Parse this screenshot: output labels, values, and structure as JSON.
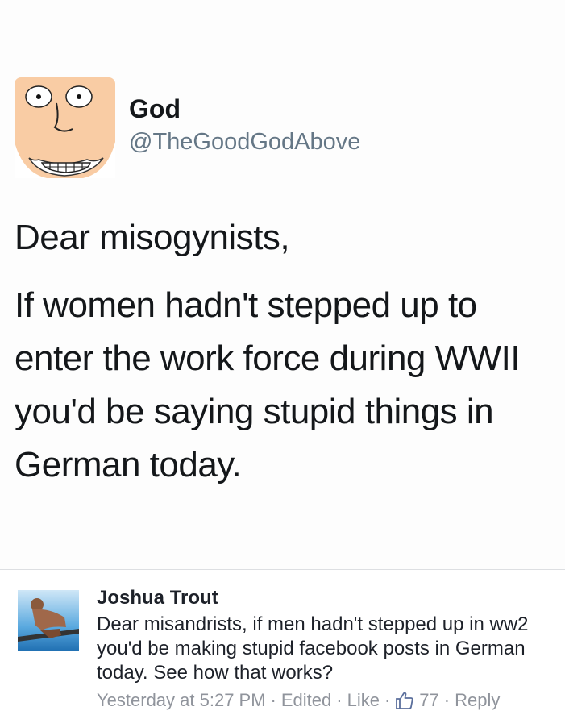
{
  "tweet": {
    "author": {
      "name": "God",
      "handle": "@TheGoodGodAbove",
      "avatar_icon": "cartoon-god-face-icon"
    },
    "greeting": "Dear misogynists,",
    "body": "If women hadn't stepped up to enter the work force during WWII you'd be saying stupid things in German today."
  },
  "comment": {
    "author": "Joshua Trout",
    "avatar_icon": "profile-photo",
    "text": "Dear misandrists, if men hadn't stepped up in ww2 you'd be making stupid facebook posts in German today. See how that works?",
    "timestamp": "Yesterday at 5:27 PM",
    "edited_label": "Edited",
    "like_label": "Like",
    "like_count": "77",
    "reply_label": "Reply",
    "separator": "·",
    "like_icon": "thumbs-up-icon"
  },
  "colors": {
    "text": "#14171a",
    "handle": "#657786",
    "meta": "#90949c",
    "avatar_skin": "#f9cca4"
  }
}
